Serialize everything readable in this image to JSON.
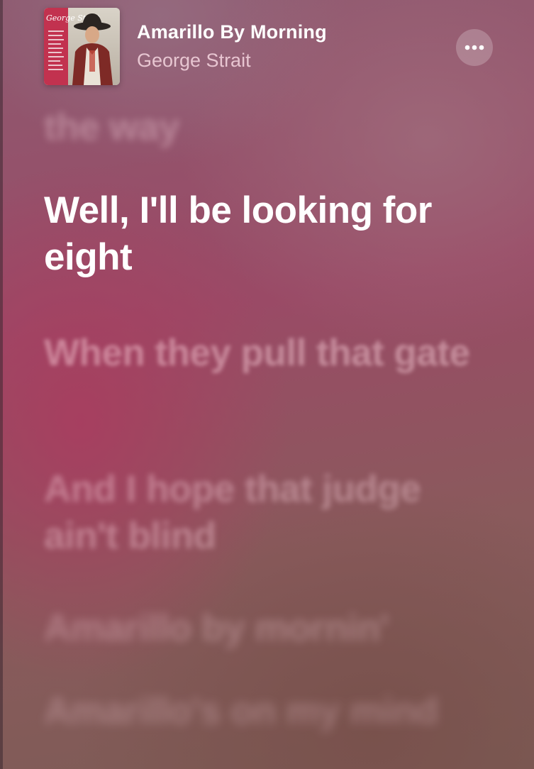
{
  "now_playing": {
    "title": "Amarillo By Morning",
    "artist": "George Strait",
    "album_art": {
      "label": "album-artwork",
      "cover_text": "George Strait"
    },
    "more_icon": "ellipsis-icon"
  },
  "lyrics": {
    "previous": "the way",
    "current": "Well, I'll be looking for eight",
    "upcoming": [
      "When they pull that gate",
      "And I hope that judge ain't blind",
      "Amarillo by mornin'",
      "Amarillo's on my mind"
    ]
  },
  "colors": {
    "current_lyric": "#ffffff",
    "background_primary": "#9a4a66",
    "background_secondary": "#7c5c55"
  }
}
